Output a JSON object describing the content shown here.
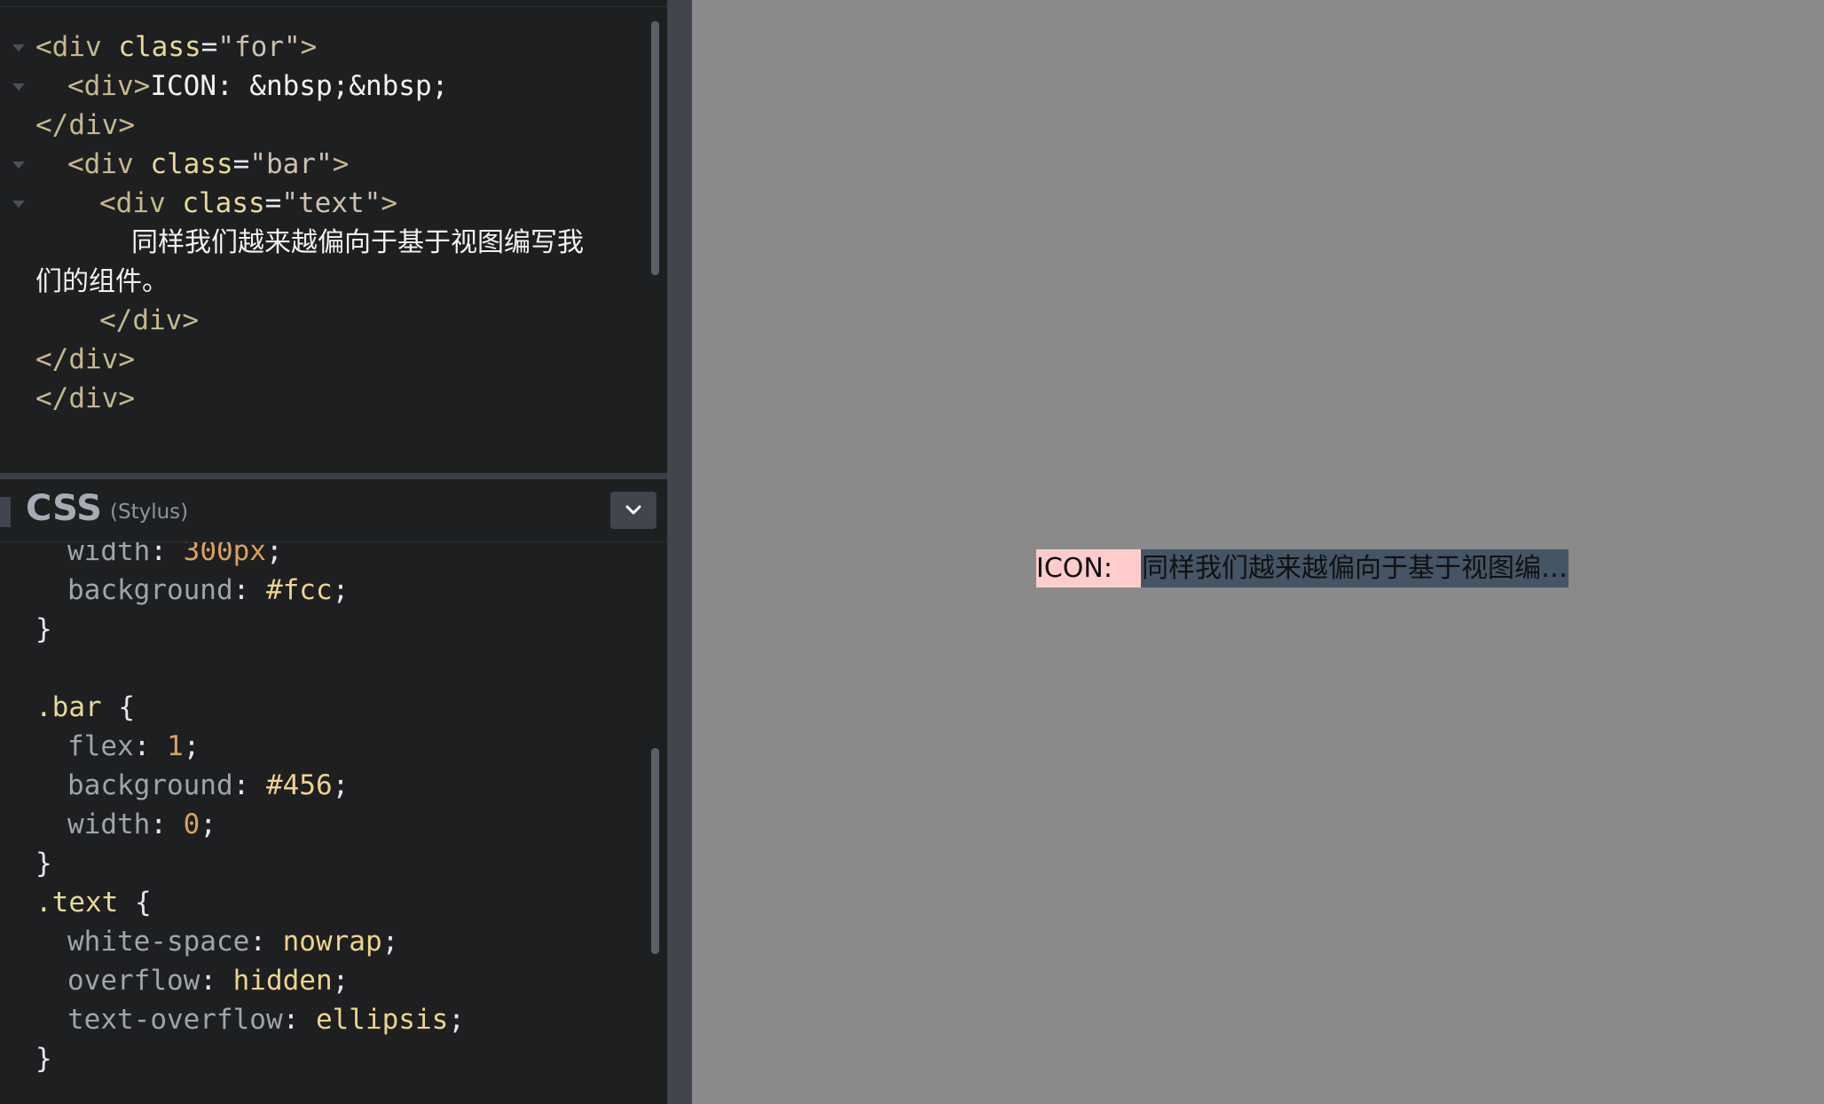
{
  "html_pane": {
    "lines": [
      {
        "open": "<div ",
        "attr": "class",
        "eq": "=",
        "val": "\"for\"",
        "close": ">"
      },
      {
        "open": "<div>",
        "text": "ICON: &nbsp;&nbsp;"
      },
      {
        "close": "</div>"
      },
      {
        "open": "<div ",
        "attr": "class",
        "eq": "=",
        "val": "\"bar\"",
        "close": ">"
      },
      {
        "open": "<div ",
        "attr": "class",
        "eq": "=",
        "val": "\"text\"",
        "close": ">"
      },
      {
        "text": "同样我们越来越偏向于基于视图编写我"
      },
      {
        "text": "们的组件。"
      },
      {
        "close": "</div>"
      },
      {
        "close": "</div>"
      },
      {
        "close": "</div>"
      }
    ]
  },
  "css_pane": {
    "title": "CSS",
    "subtitle": "(Stylus)",
    "lines": [
      {
        "prop": "width",
        "val": "300px"
      },
      {
        "prop": "background",
        "val": "#fcc"
      },
      {
        "punc": "}"
      },
      {
        "sel": ".bar",
        "punc": " {"
      },
      {
        "prop": "flex",
        "val": "1"
      },
      {
        "prop": "background",
        "val": "#456"
      },
      {
        "prop": "width",
        "val": "0"
      },
      {
        "punc": "}"
      },
      {
        "sel": ".text",
        "punc": " {"
      },
      {
        "prop": "white-space",
        "val": "nowrap"
      },
      {
        "prop": "overflow",
        "val": "hidden"
      },
      {
        "prop": "text-overflow",
        "val": "ellipsis"
      },
      {
        "punc": "}"
      }
    ]
  },
  "preview": {
    "icon_label": "ICON:  ",
    "text": "同样我们越来越偏向于基于视图编写我们的组件。",
    "for_bg": "#ffcccc",
    "bar_bg": "#445566"
  },
  "colors": {
    "editor_bg": "#1d1f21",
    "divider": "#41454e",
    "preview_bg": "#8a8a8a"
  },
  "icons": {
    "collapse": "chevron-down-icon",
    "fold": "fold-arrow-icon"
  }
}
